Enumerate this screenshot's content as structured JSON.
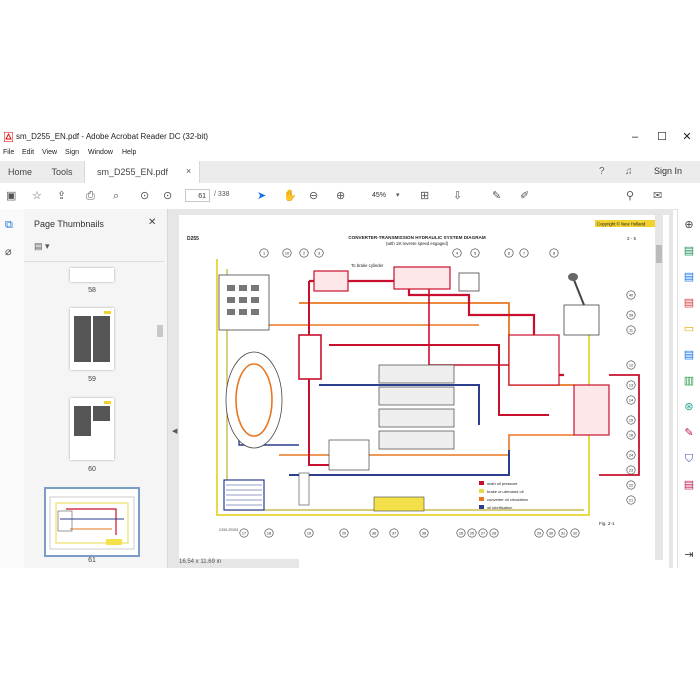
{
  "window": {
    "title": "sm_D255_EN.pdf - Adobe Acrobat Reader DC (32-bit)",
    "minimize": "–",
    "maximize": "☐",
    "close": "✕"
  },
  "menu": [
    "File",
    "Edit",
    "View",
    "Sign",
    "Window",
    "Help"
  ],
  "tabs": {
    "home": "Home",
    "tools": "Tools",
    "document": "sm_D255_EN.pdf",
    "close": "×",
    "sign_in": "Sign In"
  },
  "toolbar": {
    "page_current": "61",
    "page_total": "/ 338",
    "zoom": "45%"
  },
  "panel": {
    "title": "Page Thumbnails",
    "thumbnails": [
      {
        "label": "58"
      },
      {
        "label": "59"
      },
      {
        "label": "60"
      },
      {
        "label": "61"
      }
    ]
  },
  "document": {
    "copyright": "Copyright © New Holland",
    "model": "D255",
    "page_ref": "2 - 5",
    "title_line1": "CONVERTER-TRANSMISSION HYDRAULIC SYSTEM DIAGRAM",
    "title_line2": "(with 1st reverse speed engaged)",
    "brake_label": "To brake cylinder",
    "fig": "Fig. 2-1",
    "code": "D255-2R053",
    "legend": [
      {
        "text": "main oil pressure",
        "color": "#c8102e"
      },
      {
        "text": "brake on-demand oil",
        "color": "#e8d84a"
      },
      {
        "text": "converter oil circulation",
        "color": "#e87722"
      },
      {
        "text": "oil lubrification",
        "color": "#2c3e8c"
      }
    ],
    "top_callouts": [
      "1",
      "10",
      "2",
      "3",
      "4",
      "5",
      "6",
      "7",
      "8"
    ],
    "bottom_callouts": [
      "17",
      "18",
      "19",
      "20",
      "36",
      "37",
      "38",
      "26",
      "25",
      "27",
      "28",
      "29",
      "30",
      "31",
      "32"
    ],
    "right_callouts": [
      "40",
      "39",
      "11",
      "12",
      "13",
      "14",
      "15",
      "16",
      "24",
      "23",
      "22",
      "21"
    ]
  },
  "status": {
    "page_size": "16.54 x 11.69 in"
  },
  "colors": {
    "main_pressure": "#c8102e",
    "brake": "#e8d84a",
    "converter": "#e87722",
    "lubrication": "#2c3e8c",
    "accent": "#1473e6"
  }
}
